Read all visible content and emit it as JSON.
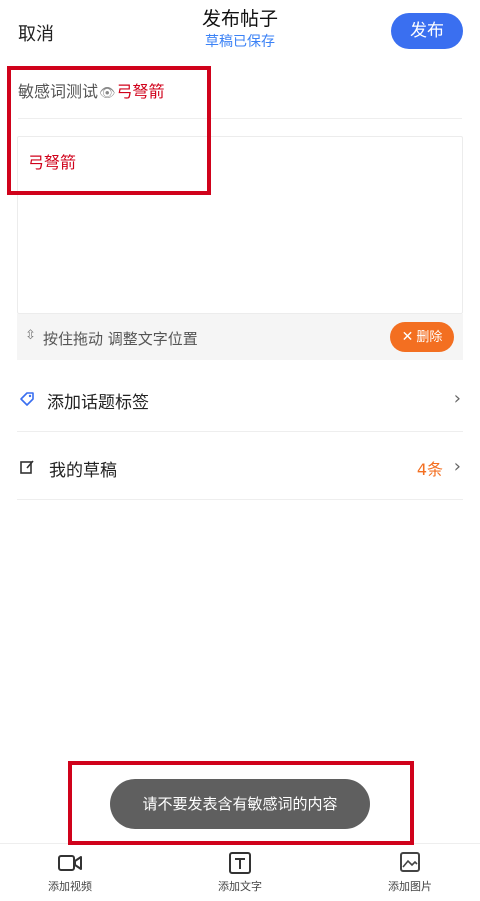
{
  "header": {
    "cancel": "取消",
    "title": "发布帖子",
    "subtitle": "草稿已保存",
    "publish": "发布"
  },
  "post": {
    "title_prefix": "敏感词测试",
    "title_eye_icon": "eye-icon",
    "title_sensitive": "弓弩箭",
    "content": "弓弩箭"
  },
  "drag_bar": {
    "hint": "按住拖动 调整文字位置",
    "delete": "删除"
  },
  "rows": {
    "topic_label": "添加话题标签",
    "drafts_label": "我的草稿",
    "drafts_count": "4条"
  },
  "toast": "请不要发表含有敏感词的内容",
  "toolbar": {
    "add_video": "添加视频",
    "add_text": "添加文字",
    "add_image": "添加图片"
  },
  "colors": {
    "accent_blue": "#3a6ff0",
    "sensitive_red": "#d0021b",
    "orange": "#f36f21"
  }
}
